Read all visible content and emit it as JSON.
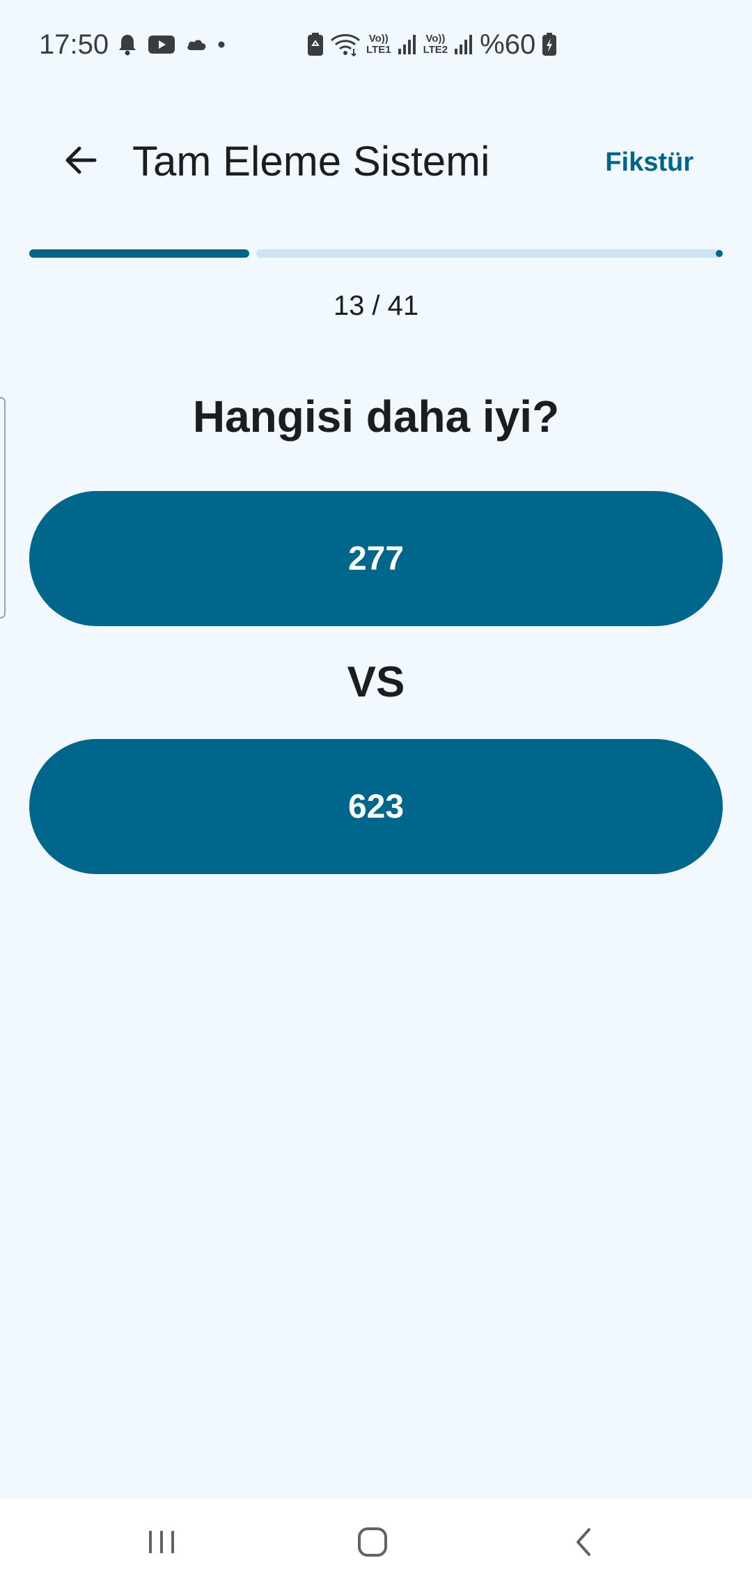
{
  "status_bar": {
    "time": "17:50",
    "lte1": [
      "Vo))",
      "LTE1"
    ],
    "lte2": [
      "Vo))",
      "LTE2"
    ],
    "battery": "%60",
    "icons": [
      "bell-icon",
      "youtube-icon",
      "cloud-icon",
      "dot-icon",
      "battery-saver-icon",
      "wifi-icon",
      "signal-icon",
      "signal-icon",
      "battery-charging-icon"
    ]
  },
  "app_bar": {
    "title": "Tam Eleme Sistemi",
    "action_label": "Fikstür",
    "back_icon": "arrow-left-icon"
  },
  "progress": {
    "current": 13,
    "total": 41,
    "label": "13 / 41"
  },
  "question": "Hangisi daha iyi?",
  "choices": [
    {
      "label": "277"
    },
    {
      "label": "623"
    }
  ],
  "vs_label": "VS",
  "colors": {
    "primary": "#00668b",
    "background": "#f1f8fe",
    "track": "#cfe5f5",
    "text": "#1b1d21"
  },
  "nav_bar": {
    "icons": [
      "recents-icon",
      "home-icon",
      "back-icon"
    ]
  }
}
